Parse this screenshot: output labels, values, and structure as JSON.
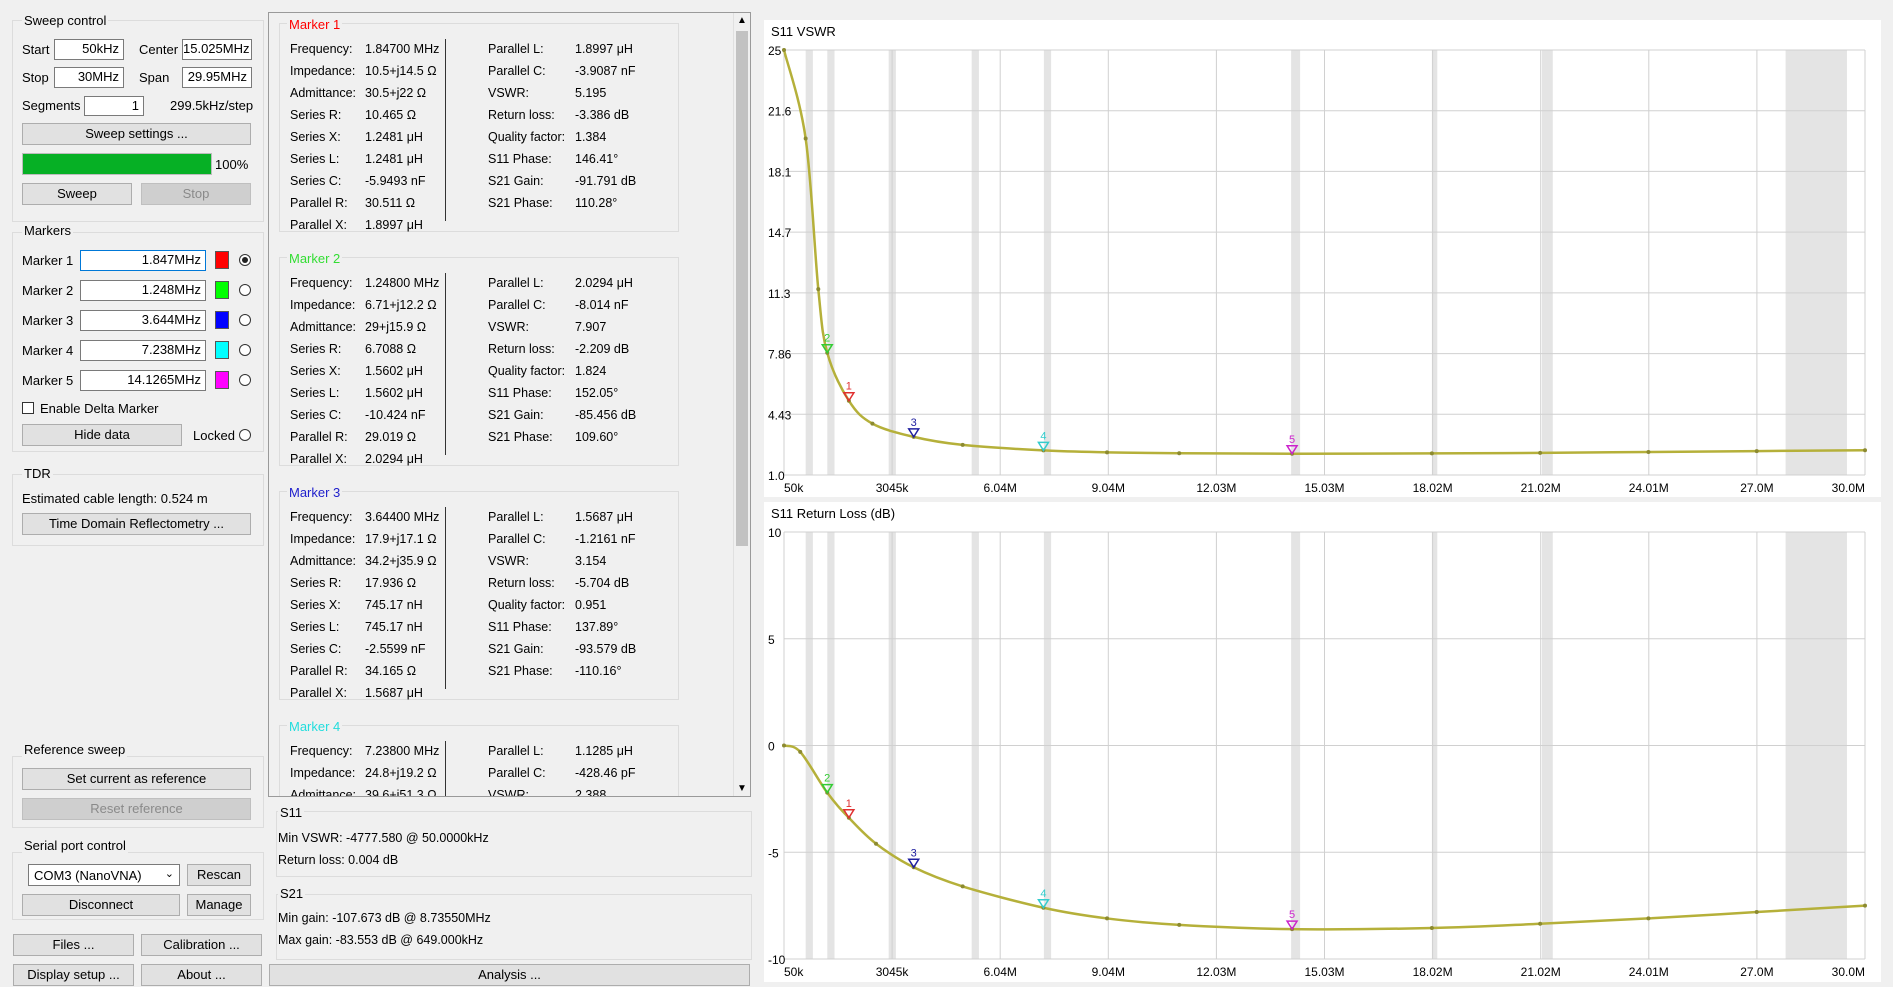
{
  "sweep": {
    "title": "Sweep control",
    "start_label": "Start",
    "start_value": "50kHz",
    "center_label": "Center",
    "center_value": "15.025MHz",
    "stop_label": "Stop",
    "stop_value": "30MHz",
    "span_label": "Span",
    "span_value": "29.95MHz",
    "segments_label": "Segments",
    "segments_value": "1",
    "step_text": "299.5kHz/step",
    "settings_button": "Sweep settings ...",
    "progress": 100,
    "progress_text": "100%",
    "sweep_button": "Sweep",
    "stop_button": "Stop"
  },
  "markers": {
    "title": "Markers",
    "items": [
      {
        "label": "Marker 1",
        "value": "1.847MHz",
        "color": "#ff0000",
        "selected": true
      },
      {
        "label": "Marker 2",
        "value": "1.248MHz",
        "color": "#00ff00",
        "selected": false
      },
      {
        "label": "Marker 3",
        "value": "3.644MHz",
        "color": "#0000ff",
        "selected": false
      },
      {
        "label": "Marker 4",
        "value": "7.238MHz",
        "color": "#00ffff",
        "selected": false
      },
      {
        "label": "Marker 5",
        "value": "14.1265MHz",
        "color": "#ff00ff",
        "selected": false
      }
    ],
    "delta_label": "Enable Delta Marker",
    "hide_button": "Hide data",
    "locked_label": "Locked"
  },
  "tdr": {
    "title": "TDR",
    "cable_text": "Estimated cable length: 0.524 m",
    "button": "Time Domain Reflectometry ..."
  },
  "reference": {
    "title": "Reference sweep",
    "set_button": "Set current as reference",
    "reset_button": "Reset reference"
  },
  "serial": {
    "title": "Serial port control",
    "port": "COM3 (NanoVNA)",
    "rescan_button": "Rescan",
    "disconnect_button": "Disconnect",
    "manage_button": "Manage"
  },
  "bottom_buttons": {
    "files": "Files ...",
    "calibration": "Calibration ...",
    "display": "Display setup ...",
    "about": "About ..."
  },
  "marker_data": [
    {
      "title": "Marker 1",
      "color": "#ff0000",
      "left": [
        [
          "Frequency:",
          "1.84700 MHz"
        ],
        [
          "Impedance:",
          "10.5+j14.5 Ω"
        ],
        [
          "Admittance:",
          "30.5+j22 Ω"
        ],
        [
          "Series R:",
          "10.465 Ω"
        ],
        [
          "Series X:",
          "1.2481 μH"
        ],
        [
          "Series L:",
          "1.2481 μH"
        ],
        [
          "Series C:",
          "-5.9493 nF"
        ],
        [
          "Parallel R:",
          "30.511 Ω"
        ],
        [
          "Parallel X:",
          "1.8997 μH"
        ]
      ],
      "right": [
        [
          "Parallel L:",
          "1.8997 μH"
        ],
        [
          "Parallel C:",
          "-3.9087 nF"
        ],
        [
          "VSWR:",
          "5.195"
        ],
        [
          "Return loss:",
          "-3.386 dB"
        ],
        [
          "Quality factor:",
          "1.384"
        ],
        [
          "S11 Phase:",
          "146.41°"
        ],
        [
          "S21 Gain:",
          "-91.791 dB"
        ],
        [
          "S21 Phase:",
          "110.28°"
        ]
      ]
    },
    {
      "title": "Marker 2",
      "color": "#33dd33",
      "left": [
        [
          "Frequency:",
          "1.24800 MHz"
        ],
        [
          "Impedance:",
          "6.71+j12.2 Ω"
        ],
        [
          "Admittance:",
          "29+j15.9 Ω"
        ],
        [
          "Series R:",
          "6.7088 Ω"
        ],
        [
          "Series X:",
          "1.5602 μH"
        ],
        [
          "Series L:",
          "1.5602 μH"
        ],
        [
          "Series C:",
          "-10.424 nF"
        ],
        [
          "Parallel R:",
          "29.019 Ω"
        ],
        [
          "Parallel X:",
          "2.0294 μH"
        ]
      ],
      "right": [
        [
          "Parallel L:",
          "2.0294 μH"
        ],
        [
          "Parallel C:",
          "-8.014 nF"
        ],
        [
          "VSWR:",
          "7.907"
        ],
        [
          "Return loss:",
          "-2.209 dB"
        ],
        [
          "Quality factor:",
          "1.824"
        ],
        [
          "S11 Phase:",
          "152.05°"
        ],
        [
          "S21 Gain:",
          "-85.456 dB"
        ],
        [
          "S21 Phase:",
          "109.60°"
        ]
      ]
    },
    {
      "title": "Marker 3",
      "color": "#2020cc",
      "left": [
        [
          "Frequency:",
          "3.64400 MHz"
        ],
        [
          "Impedance:",
          "17.9+j17.1 Ω"
        ],
        [
          "Admittance:",
          "34.2+j35.9 Ω"
        ],
        [
          "Series R:",
          "17.936 Ω"
        ],
        [
          "Series X:",
          "745.17 nH"
        ],
        [
          "Series L:",
          "745.17 nH"
        ],
        [
          "Series C:",
          "-2.5599 nF"
        ],
        [
          "Parallel R:",
          "34.165 Ω"
        ],
        [
          "Parallel X:",
          "1.5687 μH"
        ]
      ],
      "right": [
        [
          "Parallel L:",
          "1.5687 μH"
        ],
        [
          "Parallel C:",
          "-1.2161 nF"
        ],
        [
          "VSWR:",
          "3.154"
        ],
        [
          "Return loss:",
          "-5.704 dB"
        ],
        [
          "Quality factor:",
          "0.951"
        ],
        [
          "S11 Phase:",
          "137.89°"
        ],
        [
          "S21 Gain:",
          "-93.579 dB"
        ],
        [
          "S21 Phase:",
          "-110.16°"
        ]
      ]
    },
    {
      "title": "Marker 4",
      "color": "#22dddd",
      "left": [
        [
          "Frequency:",
          "7.23800 MHz"
        ],
        [
          "Impedance:",
          "24.8+j19.2 Ω"
        ],
        [
          "Admittance:",
          "39.6+j51.3 Ω"
        ]
      ],
      "right": [
        [
          "Parallel L:",
          "1.1285 μH"
        ],
        [
          "Parallel C:",
          "-428.46 pF"
        ],
        [
          "VSWR:",
          "2.388"
        ]
      ]
    }
  ],
  "s11_summary": {
    "title": "S11",
    "min_vswr": "Min VSWR:  -4777.580 @ 50.0000kHz",
    "return_loss": "Return loss: 0.004 dB"
  },
  "s21_summary": {
    "title": "S21",
    "min_gain": "Min gain:  -107.673 dB @ 8.73550MHz",
    "max_gain": "Max gain:  -83.553 dB @ 649.000kHz"
  },
  "analysis_button": "Analysis ...",
  "chart_data": [
    {
      "type": "line",
      "title": "S11 VSWR",
      "x_ticks": [
        "50k",
        "3045k",
        "6.04M",
        "9.04M",
        "12.03M",
        "15.03M",
        "18.02M",
        "21.02M",
        "24.01M",
        "27.0M",
        "30.0M"
      ],
      "y_ticks": [
        "25",
        "21.6",
        "18.1",
        "14.7",
        "11.3",
        "7.86",
        "4.43",
        "1.0"
      ],
      "xlim": [
        0.05,
        30.0
      ],
      "ylim": [
        1.0,
        25
      ],
      "trace_color": "#b5b03a",
      "x": [
        0.05,
        0.65,
        1.0,
        1.248,
        1.847,
        2.5,
        3.644,
        5.0,
        7.238,
        9.0,
        11.0,
        14.1265,
        18.0,
        21.0,
        24.0,
        27.0,
        30.0
      ],
      "y": [
        25,
        20.0,
        11.5,
        7.907,
        5.195,
        3.9,
        3.154,
        2.7,
        2.388,
        2.28,
        2.23,
        2.2,
        2.22,
        2.25,
        2.3,
        2.35,
        2.4
      ],
      "markers": [
        {
          "label": "1",
          "x": 1.847,
          "y": 5.195,
          "color": "#e03030"
        },
        {
          "label": "2",
          "x": 1.248,
          "y": 7.907,
          "color": "#33cc33"
        },
        {
          "label": "3",
          "x": 3.644,
          "y": 3.154,
          "color": "#2020a0"
        },
        {
          "label": "4",
          "x": 7.238,
          "y": 2.388,
          "color": "#33cccc"
        },
        {
          "label": "5",
          "x": 14.1265,
          "y": 2.2,
          "color": "#cc22cc"
        }
      ]
    },
    {
      "type": "line",
      "title": "S11 Return Loss (dB)",
      "x_ticks": [
        "50k",
        "3045k",
        "6.04M",
        "9.04M",
        "12.03M",
        "15.03M",
        "18.02M",
        "21.02M",
        "24.01M",
        "27.0M",
        "30.0M"
      ],
      "y_ticks": [
        "10",
        "5",
        "0",
        "-5",
        "-10"
      ],
      "xlim": [
        0.05,
        30.0
      ],
      "ylim": [
        -10,
        10
      ],
      "trace_color": "#b5b03a",
      "x": [
        0.05,
        0.5,
        1.248,
        1.847,
        2.6,
        3.644,
        5.0,
        7.238,
        9.0,
        11.0,
        14.1265,
        18.0,
        21.0,
        24.0,
        27.0,
        30.0
      ],
      "y": [
        0.0,
        -0.3,
        -2.209,
        -3.386,
        -4.6,
        -5.704,
        -6.6,
        -7.6,
        -8.1,
        -8.4,
        -8.6,
        -8.55,
        -8.35,
        -8.1,
        -7.8,
        -7.5
      ],
      "markers": [
        {
          "label": "1",
          "x": 1.847,
          "y": -3.386,
          "color": "#e03030"
        },
        {
          "label": "2",
          "x": 1.248,
          "y": -2.209,
          "color": "#33cc33"
        },
        {
          "label": "3",
          "x": 3.644,
          "y": -5.704,
          "color": "#2020a0"
        },
        {
          "label": "4",
          "x": 7.238,
          "y": -7.6,
          "color": "#33cccc"
        },
        {
          "label": "5",
          "x": 14.1265,
          "y": -8.6,
          "color": "#cc22cc"
        }
      ]
    }
  ]
}
